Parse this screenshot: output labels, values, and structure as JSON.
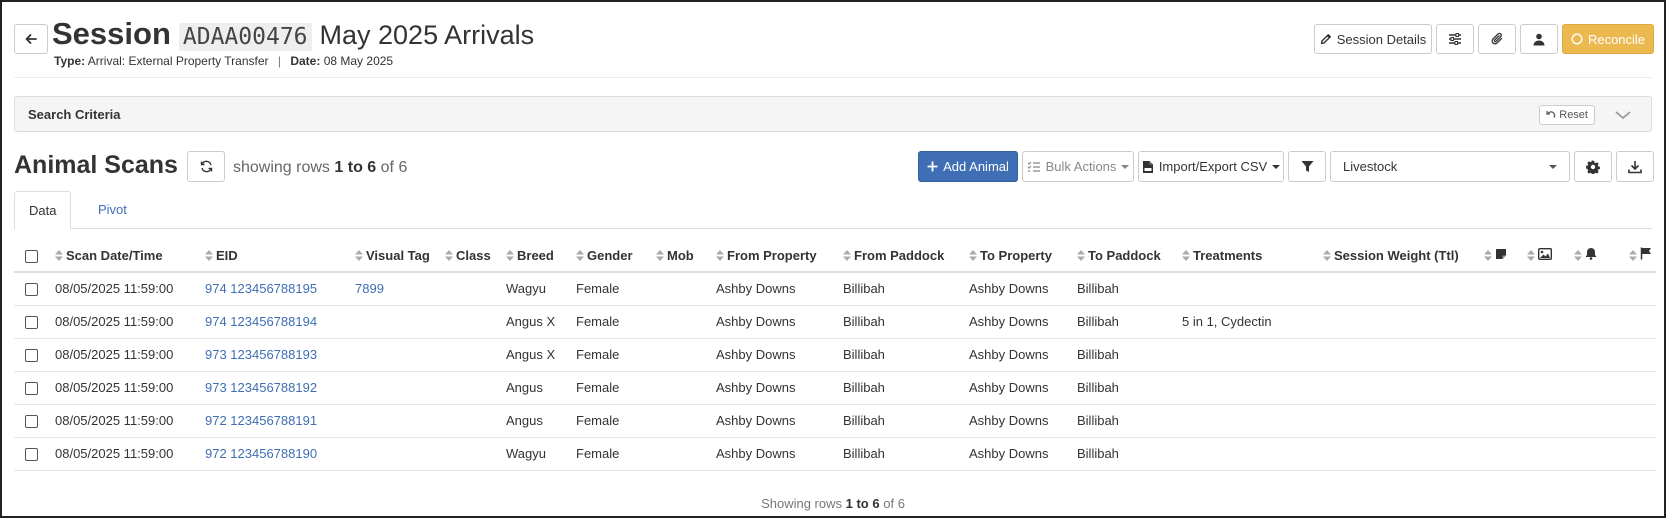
{
  "header": {
    "back_icon": "arrow-left-icon",
    "title_prefix": "Session",
    "session_code": "ADAA00476",
    "session_name": "May 2025 Arrivals",
    "type_label": "Type:",
    "type_value": "Arrival: External Property Transfer",
    "separator": "|",
    "date_label": "Date:",
    "date_value": "08 May 2025"
  },
  "top_actions": {
    "session_details_label": "Session Details",
    "reconcile_label": "Reconcile",
    "accent_color": "#ecb950"
  },
  "search": {
    "title": "Search Criteria",
    "reset_label": "Reset"
  },
  "scans": {
    "title": "Animal Scans",
    "showing_prefix": "showing rows",
    "range": "1 to 6",
    "of_word": "of",
    "total": "6"
  },
  "toolbar": {
    "add_animal_label": "Add Animal",
    "bulk_actions_label": "Bulk Actions",
    "import_export_label": "Import/Export CSV",
    "view_select_value": "Livestock",
    "primary_color": "#3f6eb5"
  },
  "tabs": [
    {
      "label": "Data",
      "active": true
    },
    {
      "label": "Pivot",
      "active": false
    }
  ],
  "table": {
    "columns": [
      "Scan Date/Time",
      "EID",
      "Visual Tag",
      "Class",
      "Breed",
      "Gender",
      "Mob",
      "From Property",
      "From Paddock",
      "To Property",
      "To Paddock",
      "Treatments",
      "Session Weight (Ttl)"
    ],
    "icon_columns": [
      "note-icon",
      "image-icon",
      "bell-icon",
      "flag-icon"
    ],
    "rows": [
      {
        "scan": "08/05/2025 11:59:00",
        "eid": "974 123456788195",
        "visual_tag": "7899",
        "class": "",
        "breed": "Wagyu",
        "gender": "Female",
        "mob": "",
        "from_property": "Ashby Downs",
        "from_paddock": "Billibah",
        "to_property": "Ashby Downs",
        "to_paddock": "Billibah",
        "treatments": "",
        "weight": ""
      },
      {
        "scan": "08/05/2025 11:59:00",
        "eid": "974 123456788194",
        "visual_tag": "",
        "class": "",
        "breed": "Angus X",
        "gender": "Female",
        "mob": "",
        "from_property": "Ashby Downs",
        "from_paddock": "Billibah",
        "to_property": "Ashby Downs",
        "to_paddock": "Billibah",
        "treatments": "5 in 1, Cydectin",
        "weight": ""
      },
      {
        "scan": "08/05/2025 11:59:00",
        "eid": "973 123456788193",
        "visual_tag": "",
        "class": "",
        "breed": "Angus X",
        "gender": "Female",
        "mob": "",
        "from_property": "Ashby Downs",
        "from_paddock": "Billibah",
        "to_property": "Ashby Downs",
        "to_paddock": "Billibah",
        "treatments": "",
        "weight": ""
      },
      {
        "scan": "08/05/2025 11:59:00",
        "eid": "973 123456788192",
        "visual_tag": "",
        "class": "",
        "breed": "Angus",
        "gender": "Female",
        "mob": "",
        "from_property": "Ashby Downs",
        "from_paddock": "Billibah",
        "to_property": "Ashby Downs",
        "to_paddock": "Billibah",
        "treatments": "",
        "weight": ""
      },
      {
        "scan": "08/05/2025 11:59:00",
        "eid": "972 123456788191",
        "visual_tag": "",
        "class": "",
        "breed": "Angus",
        "gender": "Female",
        "mob": "",
        "from_property": "Ashby Downs",
        "from_paddock": "Billibah",
        "to_property": "Ashby Downs",
        "to_paddock": "Billibah",
        "treatments": "",
        "weight": ""
      },
      {
        "scan": "08/05/2025 11:59:00",
        "eid": "972 123456788190",
        "visual_tag": "",
        "class": "",
        "breed": "Wagyu",
        "gender": "Female",
        "mob": "",
        "from_property": "Ashby Downs",
        "from_paddock": "Billibah",
        "to_property": "Ashby Downs",
        "to_paddock": "Billibah",
        "treatments": "",
        "weight": ""
      }
    ]
  },
  "footer": {
    "prefix": "Showing rows",
    "range": "1 to 6",
    "of_word": "of",
    "total": "6"
  }
}
